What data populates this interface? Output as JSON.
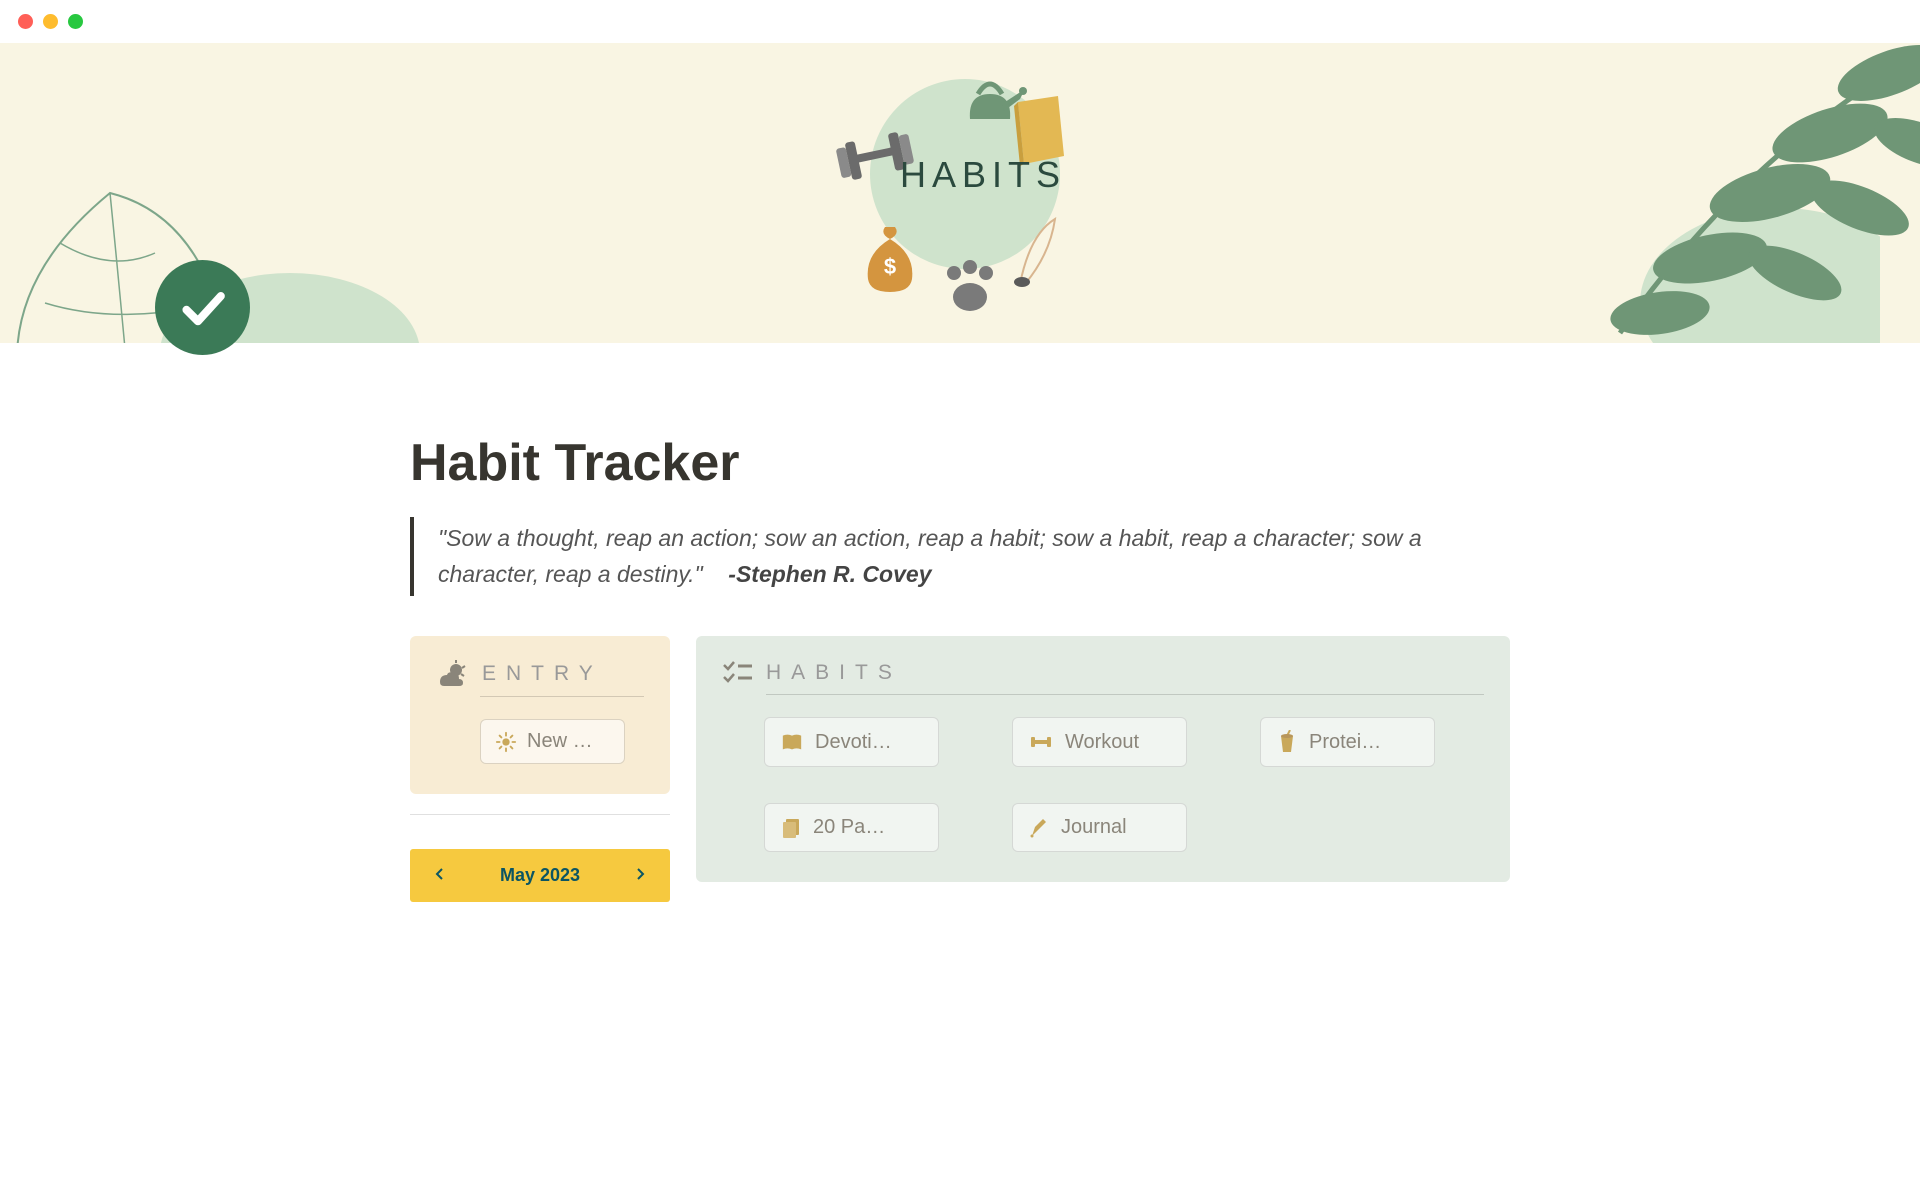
{
  "cover": {
    "badge_text": "HABITS"
  },
  "page": {
    "title": "Habit Tracker"
  },
  "quote": {
    "text": "\"Sow a thought, reap an action; sow an action, reap a habit; sow a habit, reap a character; sow a character, reap a destiny.\"",
    "author": "-Stephen R. Covey"
  },
  "entry": {
    "heading": "ENTRY",
    "new_label": "New …"
  },
  "habits": {
    "heading": "HABITS",
    "items": [
      {
        "label": "Devoti…"
      },
      {
        "label": "Workout"
      },
      {
        "label": "Protei…"
      },
      {
        "label": "20 Pa…"
      },
      {
        "label": "Journal"
      }
    ]
  },
  "calendar": {
    "month_label": "May 2023"
  }
}
